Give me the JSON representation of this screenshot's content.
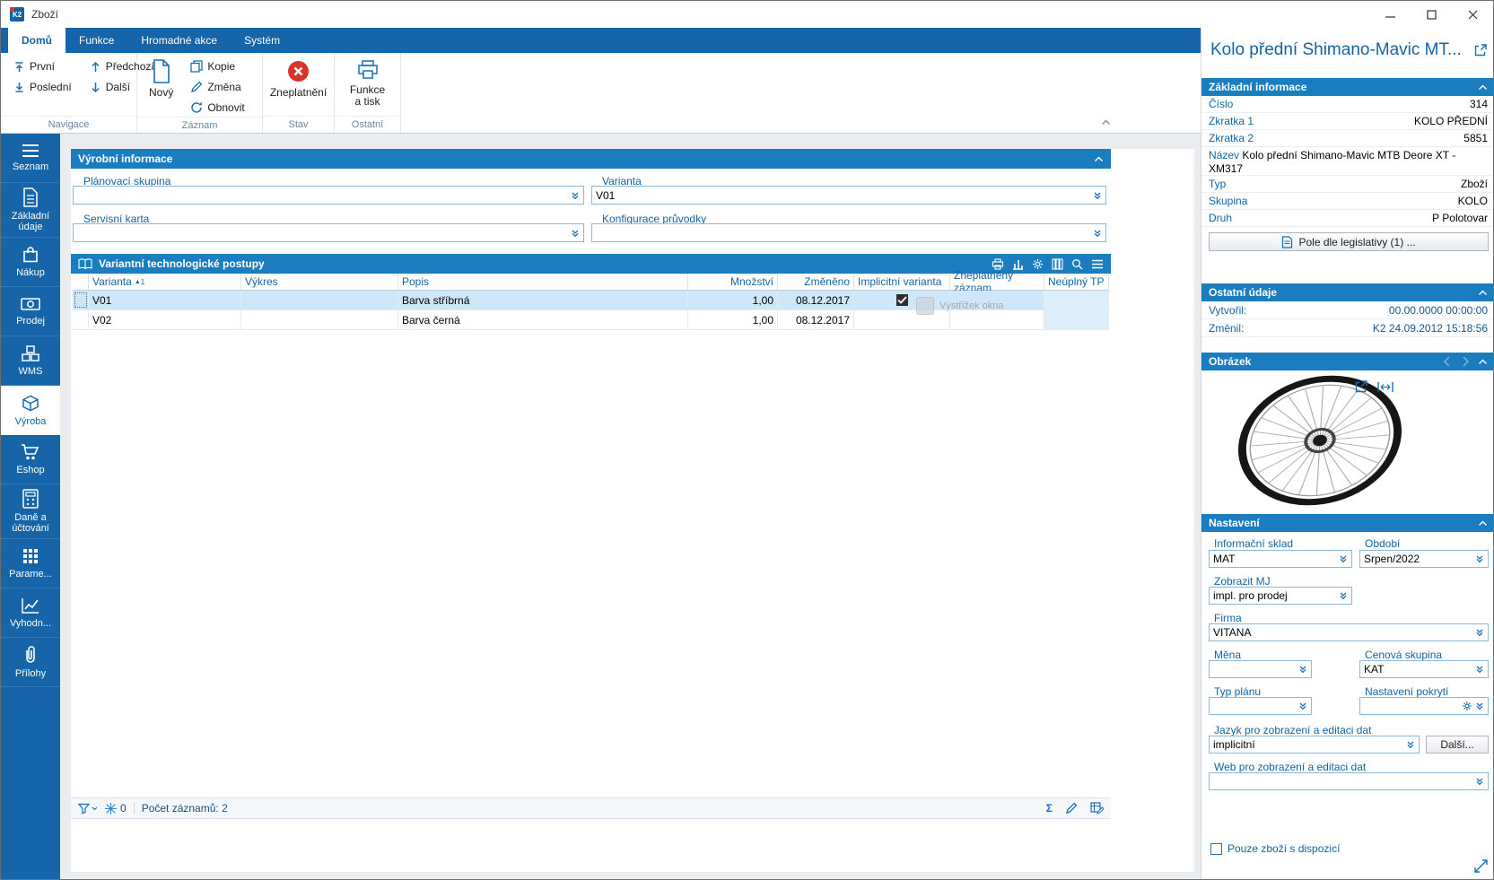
{
  "window": {
    "title": "Zboží"
  },
  "tabs": [
    {
      "label": "Domů"
    },
    {
      "label": "Funkce"
    },
    {
      "label": "Hromadné akce"
    },
    {
      "label": "Systém"
    }
  ],
  "ribbon": {
    "navigace": {
      "label": "Navigace",
      "prvni": "První",
      "posledni": "Poslední",
      "predchozi": "Předchozí",
      "dalsi": "Další"
    },
    "zaznam": {
      "label": "Záznam",
      "novy": "Nový",
      "kopie": "Kopie",
      "zmena": "Změna",
      "obnovit": "Obnovit"
    },
    "stav": {
      "label": "Stav",
      "zneplatneni": "Zneplatnění"
    },
    "ostatni": {
      "label": "Ostatní",
      "funkce_a_tisk": "Funkce a tisk"
    }
  },
  "sidebar": {
    "items": [
      {
        "label": "Seznam"
      },
      {
        "label": "Základní údaje"
      },
      {
        "label": "Nákup"
      },
      {
        "label": "Prodej"
      },
      {
        "label": "WMS"
      },
      {
        "label": "Výroba",
        "active": true
      },
      {
        "label": "Eshop"
      },
      {
        "label": "Daně a účtování"
      },
      {
        "label": "Parame..."
      },
      {
        "label": "Vyhodn..."
      },
      {
        "label": "Přílohy"
      }
    ]
  },
  "main": {
    "vyrobni_informace": {
      "title": "Výrobní informace",
      "planovaci_skupina": {
        "label": "Plánovací skupina",
        "value": ""
      },
      "varianta": {
        "label": "Varianta",
        "value": "V01"
      },
      "servisni_karta": {
        "label": "Servisní karta",
        "value": ""
      },
      "konfigurace_pruvodky": {
        "label": "Konfigurace průvodky",
        "value": ""
      }
    },
    "postupy": {
      "title": "Variantní technologické postupy",
      "sort": {
        "arrow": "▲",
        "order": "1"
      },
      "columns": [
        "Varianta",
        "Výkres",
        "Popis",
        "Množství",
        "Změněno",
        "Implicitní varianta",
        "Zneplatněný záznam",
        "Neúplný TP"
      ],
      "rows": [
        {
          "varianta": "V01",
          "vykres": "",
          "popis": "Barva stříbrná",
          "mnozstvi": "1,00",
          "zmeneno": "08.12.2017",
          "implicitni_varianta": true,
          "zneplatneny_zaznam": false,
          "neuplny_tp": ""
        },
        {
          "varianta": "V02",
          "vykres": "",
          "popis": "Barva černá",
          "mnozstvi": "1,00",
          "zmeneno": "08.12.2017",
          "implicitni_varianta": false,
          "zneplatneny_zaznam": false,
          "neuplny_tp": ""
        }
      ]
    },
    "footer": {
      "filter_badge": "0",
      "records": "Počet záznamů: 2",
      "sigma": "Σ"
    },
    "artifact": {
      "label": "Výstřižek okna"
    }
  },
  "detail": {
    "title": "Kolo přední Shimano-Mavic MT...",
    "zakladni_informace": {
      "title": "Základní informace",
      "rows": [
        {
          "label": "Číslo",
          "value": "314"
        },
        {
          "label": "Zkratka 1",
          "value": "KOLO PŘEDNÍ"
        },
        {
          "label": "Zkratka 2",
          "value": "5851"
        },
        {
          "label": "Název",
          "value": "Kolo přední Shimano-Mavic MTB Deore XT - XM317"
        },
        {
          "label": "Typ",
          "value": "Zboží"
        },
        {
          "label": "Skupina",
          "value": "KOLO"
        },
        {
          "label": "Druh",
          "value": "P Polotovar"
        }
      ],
      "legislativa_button": "Pole dle legislativy (1) ..."
    },
    "ostatni_udaje": {
      "title": "Ostatní údaje",
      "rows": [
        {
          "label": "Vytvořil:",
          "value": "00.00.0000 00:00:00"
        },
        {
          "label": "Změnil:",
          "value": "K2 24.09.2012 15:18:56"
        }
      ]
    },
    "obrazek": {
      "title": "Obrázek"
    },
    "nastaveni": {
      "title": "Nastavení",
      "informacni_sklad": {
        "label": "Informační sklad",
        "value": "MAT"
      },
      "obdobi": {
        "label": "Období",
        "value": "Srpen/2022"
      },
      "zobrazit_mj": {
        "label": "Zobrazit MJ",
        "value": "impl. pro prodej"
      },
      "firma": {
        "label": "Firma",
        "value": "VITANA"
      },
      "mena": {
        "label": "Měna",
        "value": ""
      },
      "cenova_skupina": {
        "label": "Cenová skupina",
        "value": "KAT"
      },
      "typ_planu": {
        "label": "Typ plánu",
        "value": ""
      },
      "nastaveni_pokryti": {
        "label": "Nastavení pokrytí",
        "value": ""
      },
      "jazyk": {
        "label": "Jazyk pro zobrazení a editaci dat",
        "value": "implicitní"
      },
      "dalsi_button": "Další...",
      "web": {
        "label": "Web pro zobrazení a editaci dat",
        "value": ""
      },
      "checkbox": {
        "label": "Pouze zboží s dispozicí",
        "checked": false
      }
    }
  }
}
